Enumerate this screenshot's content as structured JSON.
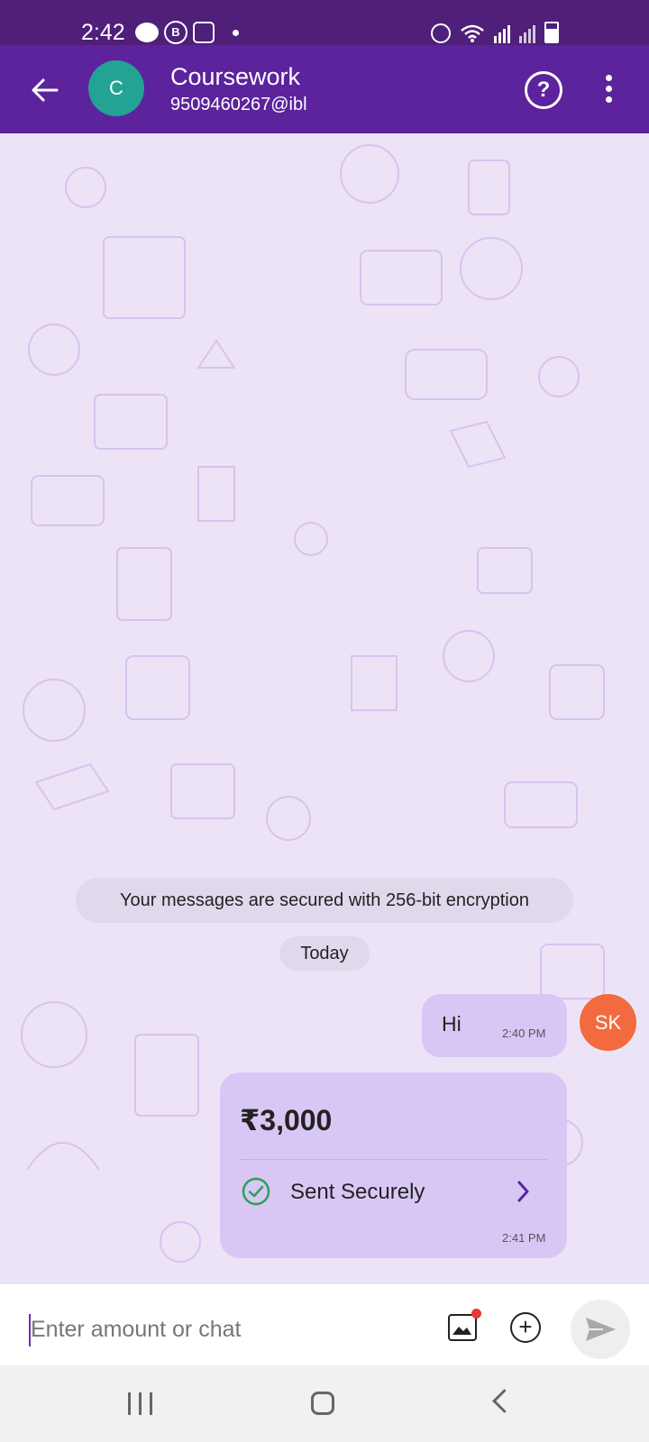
{
  "status_bar": {
    "time": "2:42"
  },
  "app_bar": {
    "avatar_letter": "C",
    "name": "Coursework",
    "upi_id": "9509460267@ibl",
    "help_symbol": "?"
  },
  "chat": {
    "encryption_notice": "Your messages are secured with 256-bit encryption",
    "date_chip": "Today",
    "messages": [
      {
        "text": "Hi",
        "time": "2:40 PM",
        "sender_initials": "SK"
      }
    ],
    "payment": {
      "amount": "₹3,000",
      "status": "Sent Securely",
      "time": "2:41 PM"
    }
  },
  "input": {
    "placeholder": "Enter amount or chat"
  },
  "icons": {
    "back": "arrow-left-icon",
    "help": "help-circle-icon",
    "more": "more-vertical-icon",
    "gallery": "gallery-icon",
    "add": "plus-circle-icon",
    "send": "send-icon",
    "check": "check-circle-icon",
    "chevron": "chevron-right-icon"
  },
  "colors": {
    "app_bar": "#5c239d",
    "status_bar": "#4f1f7a",
    "chat_bg": "#ede3f6",
    "bubble": "#d8c7f4",
    "avatar_c": "#23a393",
    "avatar_sk": "#f26a3e",
    "success": "#2e9e5b"
  }
}
